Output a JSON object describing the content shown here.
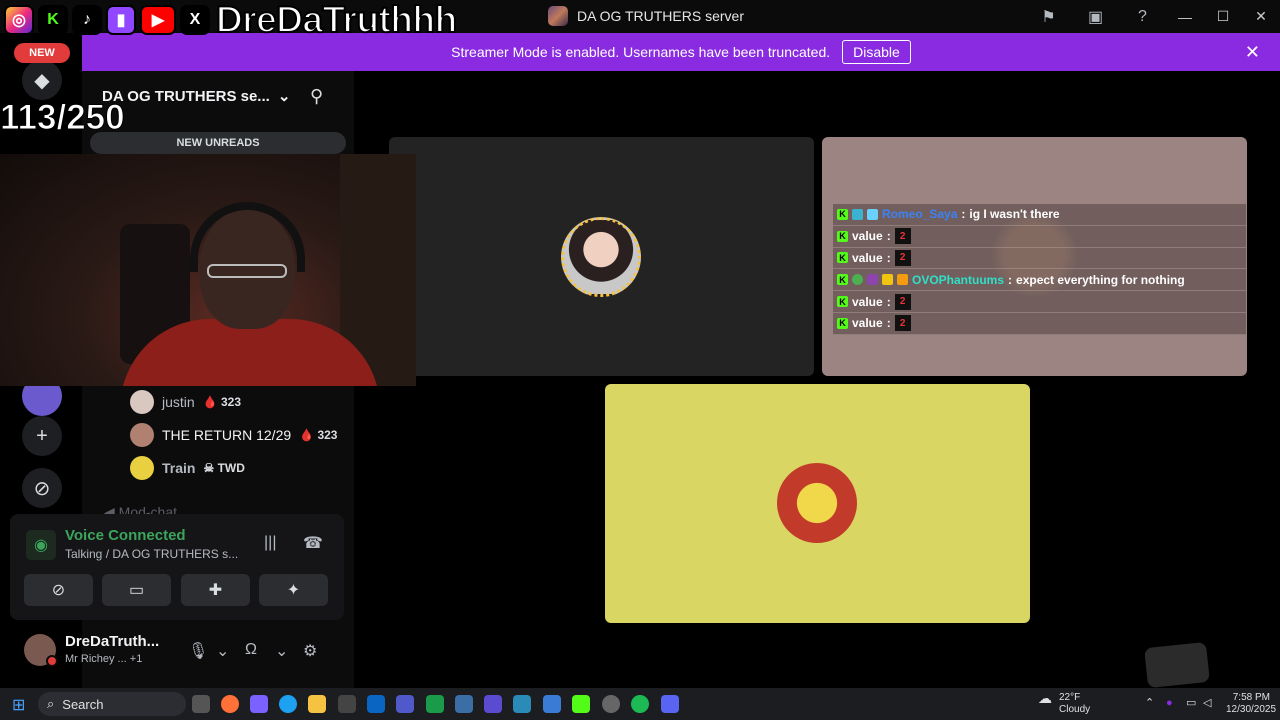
{
  "overlay": {
    "streamer_name": "DreDaTruthhh",
    "counter": "113/250",
    "social_icons": [
      "instagram-icon",
      "kick-icon",
      "tiktok-icon",
      "twitch-icon",
      "youtube-icon",
      "x-icon"
    ]
  },
  "window": {
    "title": "DA OG TRUTHERS server"
  },
  "banner": {
    "message": "Streamer Mode is enabled. Usernames have been truncated.",
    "disable_label": "Disable",
    "color": "#8a2be2"
  },
  "rail": {
    "new_label": "NEW"
  },
  "channel_panel": {
    "server_name": "DA OG TRUTHERS se...",
    "new_unreads": "NEW UNREADS",
    "members": [
      {
        "name": "justin",
        "badge": "323"
      },
      {
        "name": "THE RETURN 12/29",
        "badge": "323"
      },
      {
        "name": "Train",
        "badge": "TWD"
      }
    ],
    "mod_chat": "Mod-chat"
  },
  "voice": {
    "title": "Voice Connected",
    "subtitle": "Talking / DA OG TRUTHERS s...",
    "status_color": "#3ba55c"
  },
  "user": {
    "name": "DreDaTruth...",
    "status": "Mr Richey ... +1"
  },
  "chat": [
    {
      "user": "Romeo_Saya",
      "user_color": "#3b82f6",
      "sep": ":",
      "text": "ig I wasn't there"
    },
    {
      "user": "value",
      "user_color": "#ffffff",
      "sep": ":",
      "text": ""
    },
    {
      "user": "value",
      "user_color": "#ffffff",
      "sep": ":",
      "text": ""
    },
    {
      "user": "OVOPhantuums",
      "user_color": "#2fe0c8",
      "sep": ":",
      "text": "expect everything for nothing"
    },
    {
      "user": "value",
      "user_color": "#ffffff",
      "sep": ":",
      "text": ""
    },
    {
      "user": "value",
      "user_color": "#ffffff",
      "sep": ":",
      "text": ""
    }
  ],
  "taskbar": {
    "search_label": "Search",
    "weather_temp": "22°F",
    "weather_desc": "Cloudy",
    "time": "7:58 PM",
    "date": "12/30/2025"
  }
}
